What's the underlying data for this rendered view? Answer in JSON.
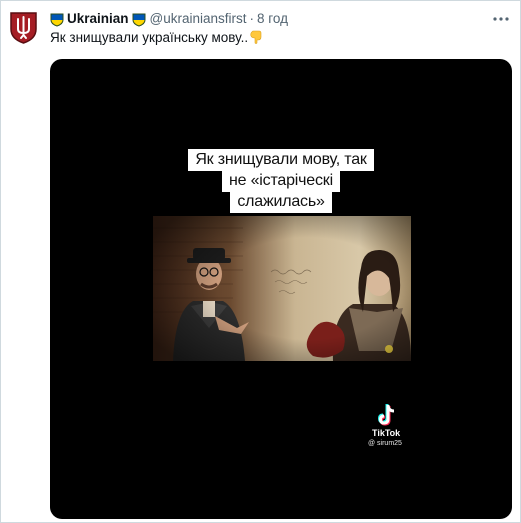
{
  "tweet": {
    "display_name": "Ukrainian",
    "handle": "@ukrainiansfirst",
    "separator": "·",
    "time": "8 год",
    "text": "Як знищували українську мову..",
    "badge_icons": [
      "ukraine-heart-icon",
      "ukraine-heart-icon"
    ],
    "trailing_emoji": "pointing-down-icon",
    "avatar_icon": "trident-shield-icon",
    "more_icon": "more-dots-icon"
  },
  "video": {
    "caption_lines": [
      "Як знищували мову, так",
      "не «істаріческі",
      "слажилась»"
    ],
    "watermark": {
      "brand": "TikTok",
      "user": "@ sirum25",
      "icon": "tiktok-logo-icon"
    }
  },
  "colors": {
    "text_primary": "#0f1419",
    "text_secondary": "#536471",
    "border": "#cfd9de",
    "media_background": "#000000",
    "flag_blue": "#0057b7",
    "flag_yellow": "#ffd700"
  }
}
